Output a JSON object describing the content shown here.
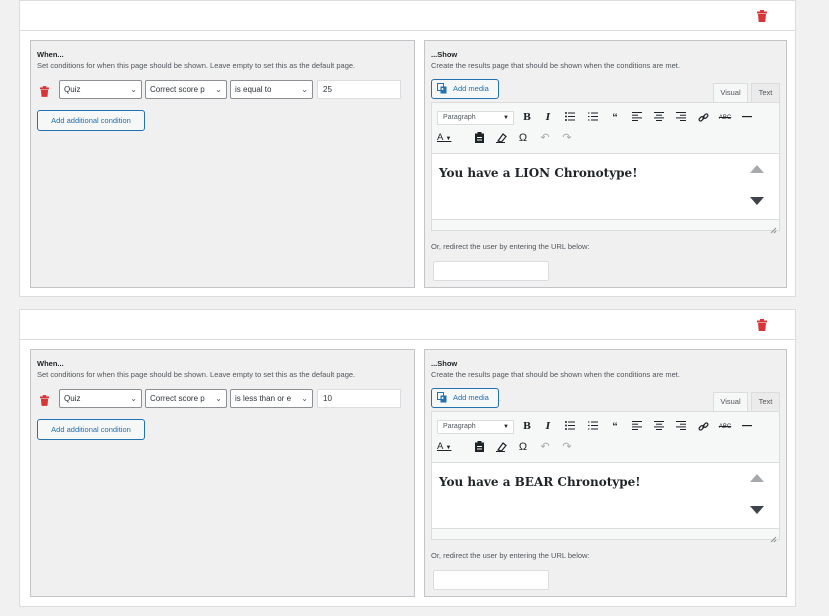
{
  "accent_color": "#2271b1",
  "delete_color": "#d63638",
  "rules": [
    {
      "when": {
        "title": "When...",
        "description": "Set conditions for when this page should be shown. Leave empty to set this as the default page.",
        "condition": {
          "source": "Quiz",
          "field": "Correct score p",
          "operator": "is equal to",
          "value": "25"
        },
        "add_condition_label": "Add additional condition"
      },
      "show": {
        "title": "...Show",
        "description": "Create the results page that should be shown when the conditions are met.",
        "add_media_label": "Add media",
        "tabs": {
          "visual": "Visual",
          "text": "Text"
        },
        "format_select": "Paragraph",
        "content": "You have a LION Chronotype!",
        "redirect_label": "Or, redirect the user by entering the URL below:",
        "redirect_value": ""
      }
    },
    {
      "when": {
        "title": "When...",
        "description": "Set conditions for when this page should be shown. Leave empty to set this as the default page.",
        "condition": {
          "source": "Quiz",
          "field": "Correct score p",
          "operator": "is less than or e",
          "value": "10"
        },
        "add_condition_label": "Add additional condition"
      },
      "show": {
        "title": "...Show",
        "description": "Create the results page that should be shown when the conditions are met.",
        "add_media_label": "Add media",
        "tabs": {
          "visual": "Visual",
          "text": "Text"
        },
        "format_select": "Paragraph",
        "content": "You have a BEAR Chronotype!",
        "redirect_label": "Or, redirect the user by entering the URL below:",
        "redirect_value": ""
      }
    }
  ],
  "toolbar_icons": [
    "bold-icon",
    "italic-icon",
    "bullet-list-icon",
    "numbered-list-icon",
    "blockquote-icon",
    "align-left-icon",
    "align-center-icon",
    "align-right-icon",
    "link-icon",
    "strikethrough-icon",
    "horizontal-line-icon",
    "text-color-icon",
    "paste-as-text-icon",
    "clear-formatting-icon",
    "special-character-icon",
    "undo-icon",
    "redo-icon"
  ]
}
